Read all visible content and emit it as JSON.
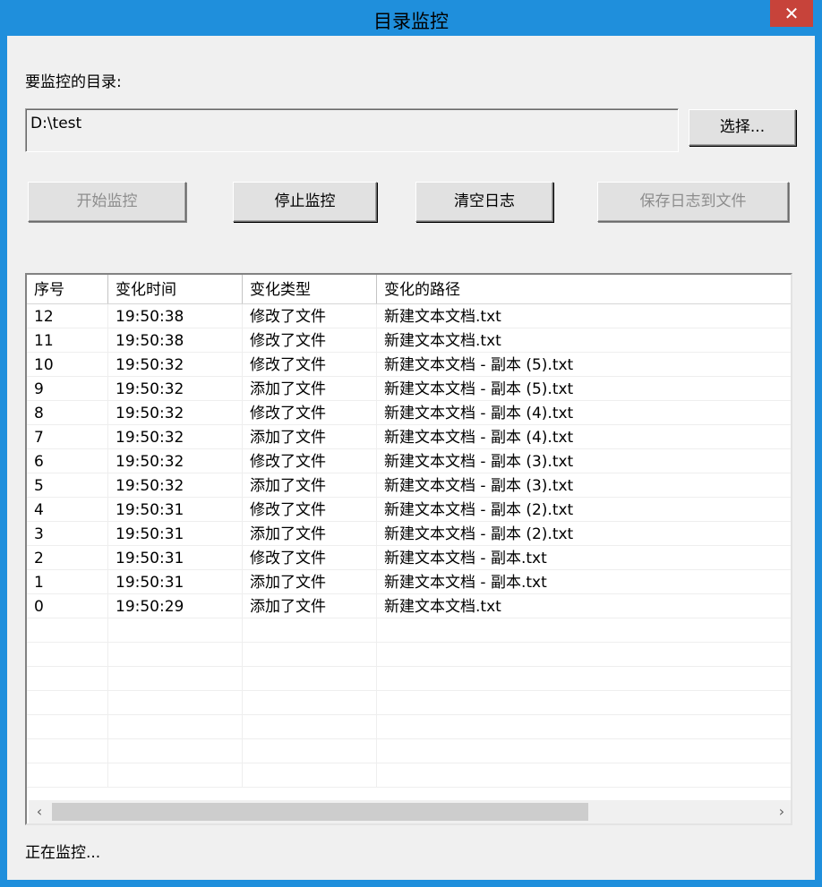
{
  "window": {
    "title": "目录监控",
    "close_label": "✕"
  },
  "directory": {
    "label": "要监控的目录:",
    "value": "D:\\test"
  },
  "buttons": {
    "select": "选择...",
    "start": "开始监控",
    "stop": "停止监控",
    "clear": "清空日志",
    "save": "保存日志到文件"
  },
  "table": {
    "columns": [
      "序号",
      "变化时间",
      "变化类型",
      "变化的路径"
    ],
    "rows": [
      [
        "12",
        "19:50:38",
        "修改了文件",
        "新建文本文档.txt"
      ],
      [
        "11",
        "19:50:38",
        "修改了文件",
        "新建文本文档.txt"
      ],
      [
        "10",
        "19:50:32",
        "修改了文件",
        "新建文本文档 - 副本 (5).txt"
      ],
      [
        "9",
        "19:50:32",
        "添加了文件",
        "新建文本文档 - 副本 (5).txt"
      ],
      [
        "8",
        "19:50:32",
        "修改了文件",
        "新建文本文档 - 副本 (4).txt"
      ],
      [
        "7",
        "19:50:32",
        "添加了文件",
        "新建文本文档 - 副本 (4).txt"
      ],
      [
        "6",
        "19:50:32",
        "修改了文件",
        "新建文本文档 - 副本 (3).txt"
      ],
      [
        "5",
        "19:50:32",
        "添加了文件",
        "新建文本文档 - 副本 (3).txt"
      ],
      [
        "4",
        "19:50:31",
        "修改了文件",
        "新建文本文档 - 副本 (2).txt"
      ],
      [
        "3",
        "19:50:31",
        "添加了文件",
        "新建文本文档 - 副本 (2).txt"
      ],
      [
        "2",
        "19:50:31",
        "修改了文件",
        "新建文本文档 - 副本.txt"
      ],
      [
        "1",
        "19:50:31",
        "添加了文件",
        "新建文本文档 - 副本.txt"
      ],
      [
        "0",
        "19:50:29",
        "添加了文件",
        "新建文本文档.txt"
      ],
      [
        "",
        "",
        "",
        ""
      ],
      [
        "",
        "",
        "",
        ""
      ],
      [
        "",
        "",
        "",
        ""
      ],
      [
        "",
        "",
        "",
        ""
      ],
      [
        "",
        "",
        "",
        ""
      ],
      [
        "",
        "",
        "",
        ""
      ],
      [
        "",
        "",
        "",
        ""
      ]
    ]
  },
  "scrollbar": {
    "left_icon": "‹",
    "right_icon": "›"
  },
  "status": "正在监控..."
}
